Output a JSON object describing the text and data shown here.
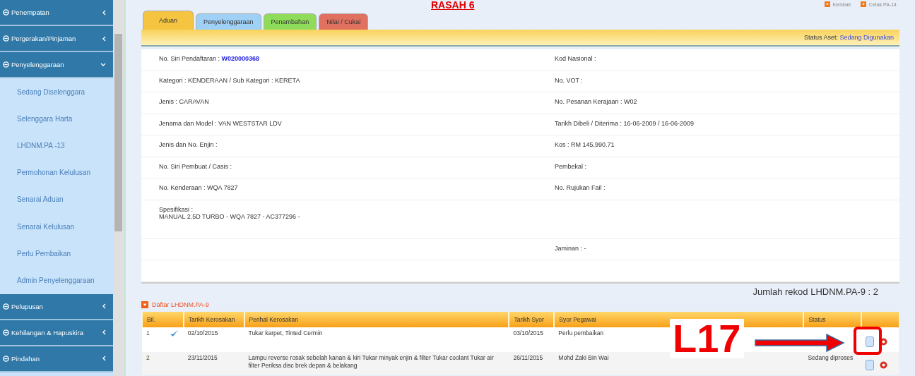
{
  "heading": "RASAH 6",
  "top_links": [
    {
      "label": "Kembali"
    },
    {
      "label": "Cetak PA-14"
    }
  ],
  "sidebar": {
    "items": [
      {
        "kind": "header",
        "label": "Penempatan",
        "expanded": false
      },
      {
        "kind": "header",
        "label": "Pergerakan/Pinjaman",
        "expanded": false
      },
      {
        "kind": "header",
        "label": "Penyelenggaraan",
        "expanded": true
      },
      {
        "kind": "sub",
        "label": "Sedang Diselenggara"
      },
      {
        "kind": "sub",
        "label": "Selenggara Harta"
      },
      {
        "kind": "sub",
        "label": "LHDNM.PA -13"
      },
      {
        "kind": "sub",
        "label": "Permohonan Kelulusan"
      },
      {
        "kind": "sub",
        "label": "Senarai Aduan"
      },
      {
        "kind": "sub",
        "label": "Senarai Kelulusan"
      },
      {
        "kind": "sub",
        "label": "Perlu Pembaikan"
      },
      {
        "kind": "sub",
        "label": "Admin Penyelenggaraan"
      },
      {
        "kind": "header",
        "label": "Pelupusan",
        "expanded": false
      },
      {
        "kind": "header",
        "label": "Kehilangan & Hapuskira",
        "expanded": false
      },
      {
        "kind": "header",
        "label": "Pindahan",
        "expanded": false
      }
    ]
  },
  "tabs": [
    {
      "label": "Aduan",
      "selected": true,
      "color": "#f5c542"
    },
    {
      "label": "Penyelenggaraan",
      "selected": false,
      "color": "#9fd0f5"
    },
    {
      "label": "Penambahan",
      "selected": false,
      "color": "#8fdc5a"
    },
    {
      "label": "Nilai / Cukai",
      "selected": false,
      "color": "#e07060"
    }
  ],
  "status_aset": {
    "label": "Status Aset:",
    "value": "Sedang Digunakan"
  },
  "details": [
    {
      "kind": "normal",
      "left": {
        "label": "No. Siri Pendaftaran :",
        "value": "W020000368",
        "link": true
      },
      "right": {
        "label": "Kod Nasional :"
      }
    },
    {
      "kind": "normal",
      "left": {
        "label": "Kategori : KENDERAAN  / Sub Kategori : KERETA"
      },
      "right": {
        "label": "No. VOT :"
      }
    },
    {
      "kind": "normal",
      "left": {
        "label": "Jenis : CARAVAN"
      },
      "right": {
        "label": "No. Pesanan Kerajaan : W02"
      }
    },
    {
      "kind": "normal",
      "left": {
        "label": "Jenama dan Model : VAN WESTSTAR LDV"
      },
      "right": {
        "label": "Tarikh Dibeli / Diterima : 16-06-2009 / 16-06-2009"
      }
    },
    {
      "kind": "normal",
      "left": {
        "label": "Jenis dan No. Enjin :"
      },
      "right": {
        "label": "Kos : RM 145,990.71"
      }
    },
    {
      "kind": "normal",
      "left": {
        "label": "No. Siri Pembuat / Casis :"
      },
      "right": {
        "label": "Pembekal :"
      }
    },
    {
      "kind": "normal",
      "left": {
        "label": "No. Kenderaan : WQA 7827"
      },
      "right": {
        "label": "No. Rujukan Fail :"
      }
    },
    {
      "kind": "tall",
      "left": {
        "label": "Spesifikasi :",
        "value": "MANUAL 2.5D TURBO    - WQA 7827 - AC377296 -"
      }
    },
    {
      "kind": "normal",
      "right": {
        "label": "Jaminan : -"
      }
    },
    {
      "kind": "normal"
    }
  ],
  "record_count": "Jumlah rekod LHDNM.PA-9 :  2",
  "list_title": "Daftar LHDNM.PA-9",
  "table": {
    "columns": [
      "Bil.",
      "Tarikh Kerosakan",
      "Perihal Kerosakan",
      "Tarikh Syor",
      "Syor Pegawai",
      "Status"
    ],
    "rows": [
      {
        "cells": [
          "1",
          "02/10/2015",
          "Tukar karpet, Tinted Cermin",
          "03/10/2015",
          "Perlu pembaikan",
          ""
        ],
        "checked": true
      },
      {
        "cells": [
          "2",
          "23/11/2015",
          "Lampu reverse rosak sebelah kanan & kiri Tukar minyak enjin & filter Tukar coolant Tukar air filter Periksa disc brek depan & belakang",
          "26/11/2015",
          "Mohd Zaki Bin Wai",
          "Sedang diproses"
        ],
        "checked": false
      }
    ]
  },
  "annotation": {
    "label": "L17"
  }
}
